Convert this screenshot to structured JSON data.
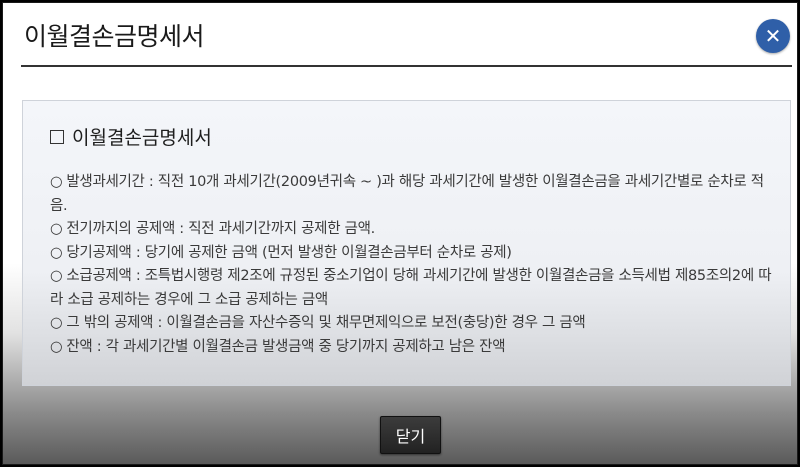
{
  "dialog": {
    "title": "이월결손금명세서",
    "close_icon": "close-icon",
    "accent_color": "#2f5fa8"
  },
  "content": {
    "section_title": "이월결손금명세서",
    "section_icon": "checkbox-icon",
    "bullet": "○",
    "items": [
      {
        "text": "발생과세기간 : 직전 10개 과세기간(2009년귀속 ~ )과 해당 과세기간에 발생한 이월결손금을 과세기간별로 순차로 적음."
      },
      {
        "text": "전기까지의 공제액 : 직전 과세기간까지 공제한 금액."
      },
      {
        "text": "당기공제액 : 당기에 공제한 금액 (먼저 발생한 이월결손금부터 순차로 공제)"
      },
      {
        "text": "소급공제액 : 조특법시행령 제2조에 규정된 중소기업이 당해 과세기간에 발생한 이월결손금을 소득세법 제85조의2에 따라 소급 공제하는 경우에 그 소급 공제하는 금액"
      },
      {
        "text": "그 밖의 공제액 : 이월결손금을 자산수증익 및 채무면제익으로 보전(충당)한 경우 그 금액"
      },
      {
        "text": "잔액 : 각 과세기간별 이월결손금 발생금액 중 당기까지 공제하고 남은 잔액"
      }
    ]
  },
  "footer": {
    "close_label": "닫기"
  }
}
